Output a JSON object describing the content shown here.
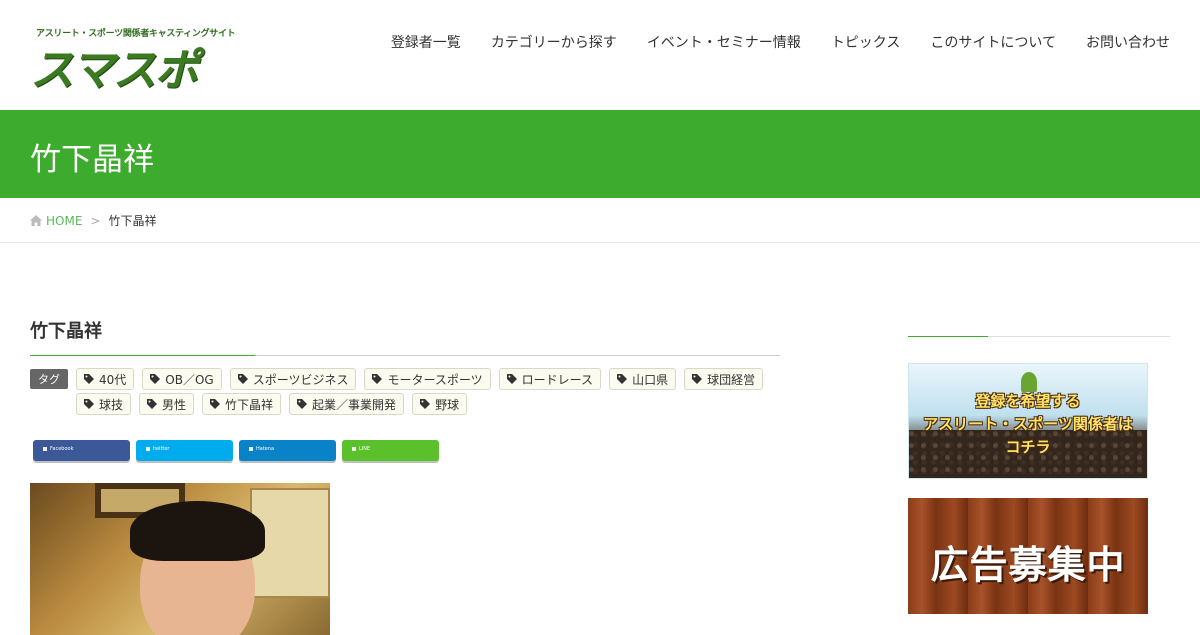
{
  "header": {
    "logo_tagline": "アスリート・スポーツ関係者キャスティングサイト",
    "logo_text": "スマスポ",
    "nav": [
      {
        "label": "登録者一覧"
      },
      {
        "label": "カテゴリーから探す"
      },
      {
        "label": "イベント・セミナー情報"
      },
      {
        "label": "トピックス"
      },
      {
        "label": "このサイトについて"
      },
      {
        "label": "お問い合わせ"
      }
    ]
  },
  "page_title": "竹下晶祥",
  "breadcrumb": {
    "home_label": "HOME",
    "separator": ">",
    "current": "竹下晶祥"
  },
  "post": {
    "title": "竹下晶祥",
    "tag_label": "タグ",
    "tags": [
      "40代",
      "OB／OG",
      "スポーツビジネス",
      "モータースポーツ",
      "ロードレース",
      "山口県",
      "球団経営",
      "球技",
      "男性",
      "竹下晶祥",
      "起業／事業開発",
      "野球"
    ],
    "share": {
      "facebook": "Facebook",
      "twitter": "twitter",
      "hatena": "Hatena",
      "line": "LINE"
    }
  },
  "sidebar": {
    "banner_register": [
      "登録を希望する",
      "アスリート・スポーツ関係者は",
      "コチラ"
    ],
    "banner_ad": "広告募集中"
  },
  "colors": {
    "brand_green": "#3dab2d",
    "link_green": "#5cb85c",
    "facebook": "#3b5998",
    "twitter": "#00aced",
    "hatena": "#0a82c7",
    "line": "#5ac12c"
  },
  "icons": {
    "home": "home-icon",
    "tag": "tag-icon"
  }
}
